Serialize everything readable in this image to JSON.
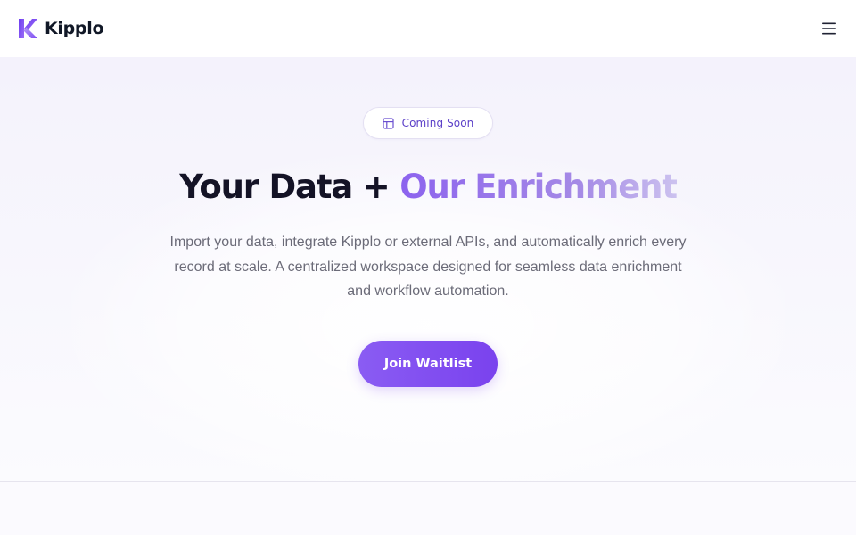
{
  "header": {
    "brand_name": "Kipplo",
    "logo_icon": "kipplo-k-logo-icon",
    "menu_icon": "hamburger-menu-icon"
  },
  "hero": {
    "badge": {
      "icon": "layout-panel-icon",
      "label": "Coming Soon"
    },
    "headline_main": "Your Data + ",
    "headline_accent": "Our Enrichment",
    "description": "Import your data, integrate Kipplo or external APIs, and automatically enrich every record at scale. A centralized workspace designed for seamless data enrichment and workflow automation.",
    "cta_label": "Join Waitlist"
  },
  "colors": {
    "brand_purple": "#7a42ee",
    "accent_gradient_start": "#8c63ee",
    "accent_gradient_end": "#ccc2ef",
    "badge_text": "#5b3fc8",
    "headline_text": "#141326",
    "body_text": "#6b6b78",
    "hero_background": "#f4f2fc"
  }
}
